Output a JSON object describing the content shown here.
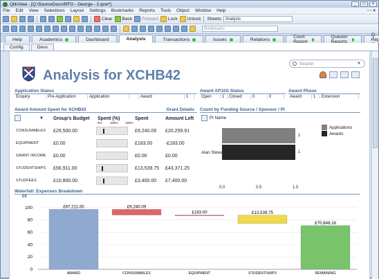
{
  "window": {
    "title": "QlikView - [Q:\\SourceDocs\\RFO - George - 2.qvw*]"
  },
  "menu": [
    "File",
    "Edit",
    "View",
    "Selections",
    "Layout",
    "Settings",
    "Bookmarks",
    "Reports",
    "Tools",
    "Object",
    "Window",
    "Help"
  ],
  "toolbar": {
    "clear": "Clear",
    "back": "Back",
    "forward": "Forward",
    "lock": "Lock",
    "unlock": "Unlock",
    "sheets_label": "Sheets",
    "sheets_value": "Analysis",
    "bookmarks_value": "Bookmarks"
  },
  "tabs": [
    {
      "label": "Help",
      "dot": false
    },
    {
      "label": "Academics",
      "dot": true
    },
    {
      "label": "Dashboard",
      "dot": false
    },
    {
      "label": "Analysis",
      "dot": false,
      "active": true
    },
    {
      "label": "Transactions",
      "dot": true
    },
    {
      "label": "Issues",
      "dot": true
    },
    {
      "label": "Relations",
      "dot": true
    },
    {
      "label": "Court Report",
      "dot": true
    },
    {
      "label": "Questor Reports",
      "dot": true
    },
    {
      "label": "Q Report Objects",
      "dot": false
    }
  ],
  "subtabs": [
    "Config",
    "Devs"
  ],
  "search": {
    "placeholder": "Search"
  },
  "page": {
    "title": "Analysis for XCHB42"
  },
  "app_status": {
    "header": "Application Status",
    "cols": [
      "Enquiry",
      "Pre-Application",
      "Application",
      "",
      "Award",
      "1"
    ]
  },
  "ap10s_status": {
    "header": "Award AP10S Status",
    "cols": [
      "Open",
      "1",
      "Closed",
      "0",
      "0"
    ]
  },
  "award_phase": {
    "header": "Award Phase",
    "cols": [
      "Award",
      "1",
      "Extension"
    ]
  },
  "spent_table": {
    "header": "Award Amount Spent for XCHB42",
    "details": "Grant Details",
    "columns": [
      "Group's Budget",
      "Spent (%)",
      "Spent",
      "Amount Left"
    ],
    "pct_scale": [
      "0%",
      "100%",
      "150%"
    ],
    "rows": [
      {
        "name": "CONSUMABLES",
        "budget": "£29,500.00",
        "pct": 0.31,
        "spent": "£9,240.09",
        "left": "£20,259.91"
      },
      {
        "name": "EQUIPMENT",
        "budget": "£0.00",
        "pct": 0,
        "spent": "£183.00",
        "left": "-£183.00"
      },
      {
        "name": "GRANT INCOME",
        "budget": "£0.00",
        "pct": 0,
        "spent": "£0.00",
        "left": "£0.00"
      },
      {
        "name": "STUDENTSHIPS",
        "budget": "£56,911.00",
        "pct": 0.24,
        "spent": "£13,539.75",
        "left": "£43,371.25"
      },
      {
        "name": "STUDFEES",
        "budget": "£10,800.00",
        "pct": 0.31,
        "spent": "£3,400.00",
        "left": "£7,400.00"
      }
    ]
  },
  "funding": {
    "header": "Count by Funding Source / Sponsor / PI",
    "dim_label": "PI Name",
    "pi": "Alan Stewart",
    "value_labels": [
      "1",
      "1"
    ],
    "ticks": [
      "0.0",
      "0.5",
      "1.0"
    ],
    "legend": [
      {
        "label": "Applications",
        "color": "#7f7f7f"
      },
      {
        "label": "Awards",
        "color": "#262626"
      }
    ]
  },
  "chart_data": {
    "type": "bar",
    "title": "Waterfall: Expenses Breakdown",
    "ylabel": "£K",
    "categories": [
      "AWARD",
      "CONSUMABLES",
      "EQUIPMENT",
      "STUDENTSHIPS",
      "REMAINING"
    ],
    "labels": [
      "£97,211.00",
      "£9,240.09",
      "£183.00",
      "£13,539.75",
      "£70,848.16"
    ],
    "base": [
      0,
      87.97,
      87.79,
      74.25,
      0
    ],
    "values": [
      97.21,
      9.24,
      0.18,
      13.54,
      70.85
    ],
    "colors": [
      "#8fa9cf",
      "#e06666",
      "#e06666",
      "#f2d94a",
      "#79c36a"
    ],
    "yticks": [
      "0",
      "20",
      "40",
      "60",
      "80",
      "100"
    ],
    "ylim": [
      0,
      110
    ]
  }
}
